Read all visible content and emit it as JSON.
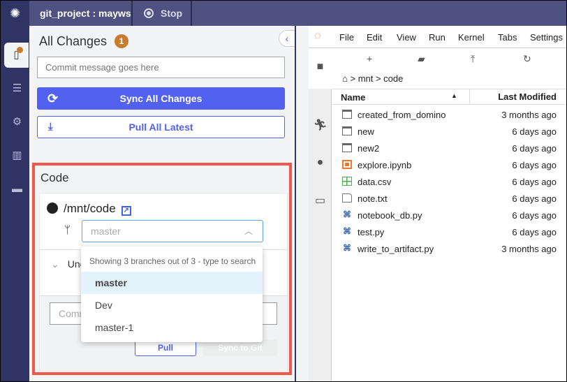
{
  "topbar": {
    "project": "git_project : mayws",
    "stop_label": "Stop"
  },
  "nav": {
    "items": [
      "changes-icon",
      "database-icon",
      "gear-icon",
      "chart-icon",
      "window-icon"
    ]
  },
  "panel": {
    "title": "All Changes",
    "badge": "1",
    "commit_placeholder": "Commit message goes here",
    "sync_label": "Sync All Changes",
    "pull_label": "Pull All Latest"
  },
  "code": {
    "title": "Code",
    "repo_path": "/mnt/code",
    "branch_value": "master",
    "section_label": "Unc",
    "commit_placeholder": "Comm",
    "pull_label": "Pull",
    "sync_label": "Sync to Git",
    "dropdown": {
      "hint": "Showing 3 branches out of 3 - type to search",
      "options": [
        "master",
        "Dev",
        "master-1"
      ],
      "selected": "master"
    }
  },
  "jupyter": {
    "menu": [
      "File",
      "Edit",
      "View",
      "Run",
      "Kernel",
      "Tabs",
      "Settings"
    ],
    "breadcrumb": {
      "home": "home-icon",
      "parts": "> mnt > code"
    },
    "columns": {
      "name": "Name",
      "modified": "Last Modified"
    },
    "files": [
      {
        "name": "created_from_domino",
        "modified": "3 months ago",
        "type": "folder"
      },
      {
        "name": "new",
        "modified": "6 days ago",
        "type": "folder"
      },
      {
        "name": "new2",
        "modified": "6 days ago",
        "type": "folder"
      },
      {
        "name": "explore.ipynb",
        "modified": "6 days ago",
        "type": "nb"
      },
      {
        "name": "data.csv",
        "modified": "6 days ago",
        "type": "csv"
      },
      {
        "name": "note.txt",
        "modified": "6 days ago",
        "type": "txt"
      },
      {
        "name": "notebook_db.py",
        "modified": "6 days ago",
        "type": "py"
      },
      {
        "name": "test.py",
        "modified": "6 days ago",
        "type": "py"
      },
      {
        "name": "write_to_artifact.py",
        "modified": "3 months ago",
        "type": "py"
      }
    ]
  },
  "colors": {
    "accent": "#5261ef",
    "badge": "#c97d2c",
    "highlight": "#f1574d",
    "nav": "#2f3464"
  }
}
